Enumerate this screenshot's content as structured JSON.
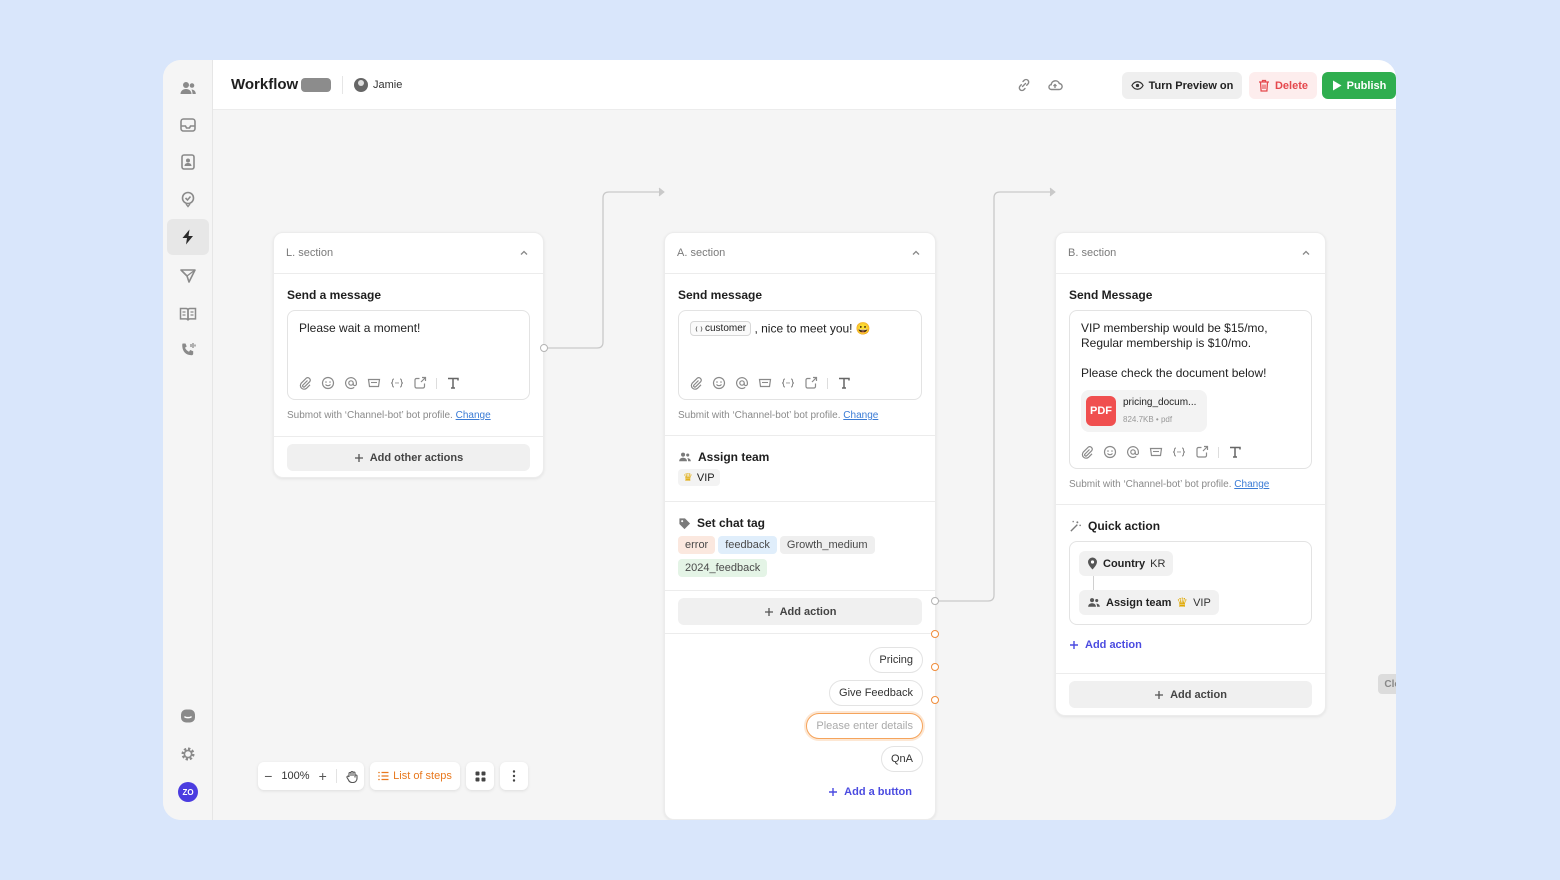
{
  "header": {
    "title": "Workflow",
    "user_name": "Jamie",
    "preview_label": "Turn Preview on",
    "delete_label": "Delete",
    "publish_label": "Publish"
  },
  "section_l": {
    "header": "L. section",
    "block_title": "Send a message",
    "message": "Please wait a moment!",
    "submit_text": "Submot with ‘Channel-bot’ bot profile.",
    "change_label": "Change",
    "add_label": "Add other actions"
  },
  "section_a": {
    "header": "A. section",
    "block_title": "Send message",
    "var_chip": "customer",
    "message_rest": ", nice to meet you! 😀",
    "submit_text": "Submit with ‘Channel-bot’ bot profile.",
    "change_label": "Change",
    "assign_title": "Assign team",
    "assign_value": "VIP",
    "tag_title": "Set chat tag",
    "tags": [
      "error",
      "feedback",
      "Growth_medium",
      "2024_feedback"
    ],
    "add_action_label": "Add action",
    "buttons": [
      "Pricing",
      "Give Feedback",
      "QnA"
    ],
    "details_placeholder": "Please enter details",
    "add_button_label": "Add a button"
  },
  "section_b": {
    "header": "B. section",
    "block_title": "Send Message",
    "message_line1": "VIP membership would be $15/mo,",
    "message_line2": "Regular membership is $10/mo.",
    "message_line3": "Please check the document below!",
    "pdf_icon": "PDF",
    "pdf_name": "pricing_docum...",
    "pdf_meta": "824.7KB • pdf",
    "submit_text": "Submit with ‘Channel-bot’ bot profile.",
    "change_label": "Change",
    "quick_title": "Quick action",
    "country_label": "Country",
    "country_value": "KR",
    "assign_label": "Assign team",
    "assign_value": "VIP",
    "add_action_link": "Add action",
    "add_action_label": "Add action",
    "close_label": "Close"
  },
  "zoombar": {
    "zoom": "100%",
    "steps_label": "List of steps"
  },
  "rail": {
    "avatar_initials": "ZO"
  },
  "colors": {
    "accent_green": "#2fae4f",
    "delete_red": "#e5484d",
    "link_blue": "#3a7bd5",
    "port_orange": "#f08c3a",
    "steps_orange": "#e8781e",
    "quick_purple": "#4b4be0"
  }
}
